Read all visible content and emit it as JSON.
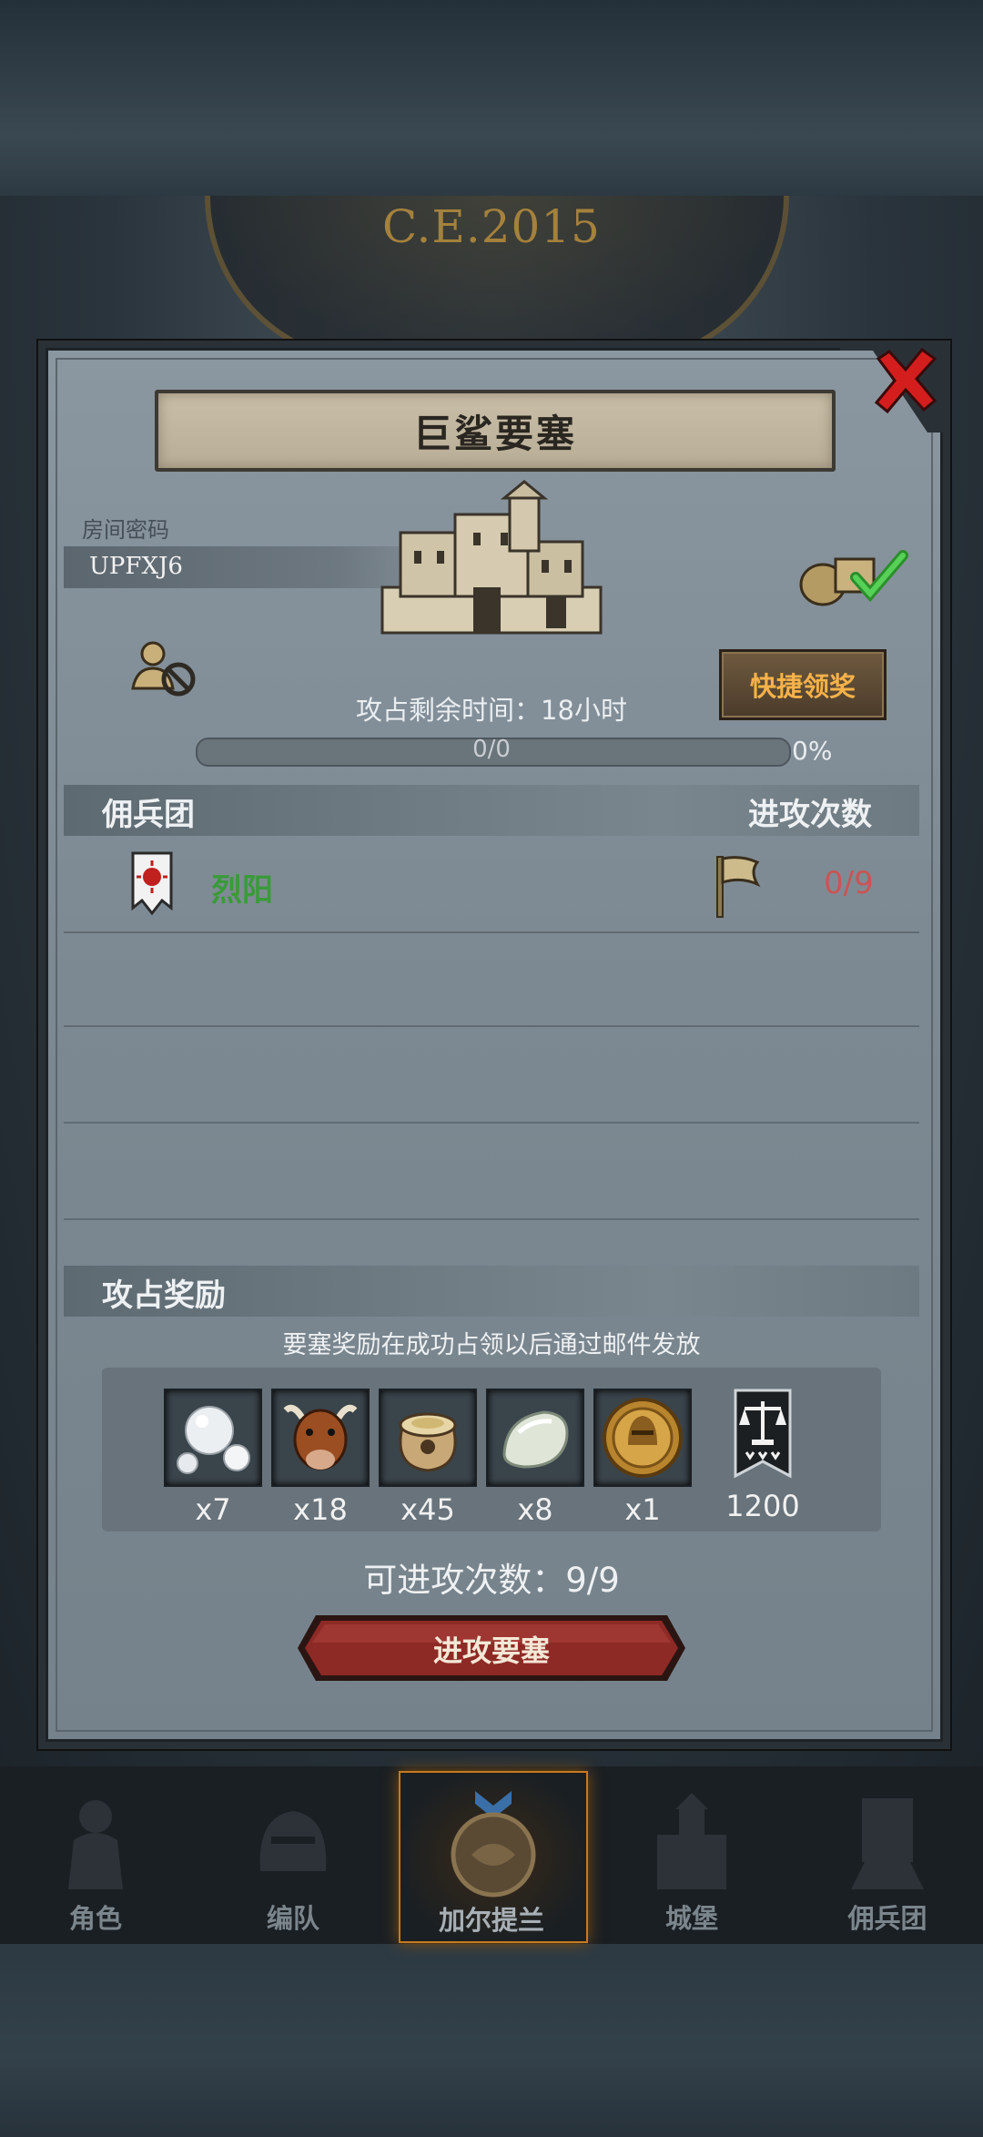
{
  "background": {
    "era_text": "C.E.2015"
  },
  "modal": {
    "title": "巨鲨要塞",
    "room_password_label": "房间密码",
    "room_password_value": "UPFXJ6",
    "quick_claim_label": "快捷领奖",
    "remaining_time_label": "攻占剩余时间：18小时",
    "progress": {
      "text": "0/0",
      "percent_text": "0%",
      "fraction": 0
    },
    "mercenary_header": "佣兵团",
    "attack_count_header": "进攻次数",
    "mercenary_rows": [
      {
        "name": "烈阳",
        "attacks": "0/9"
      }
    ],
    "rewards_header": "攻占奖励",
    "rewards_note": "要塞奖励在成功占领以后通过邮件发放",
    "rewards": [
      {
        "icon": "pearl-icon",
        "qty": "x7"
      },
      {
        "icon": "ox-icon",
        "qty": "x18"
      },
      {
        "icon": "grain-sack-icon",
        "qty": "x45"
      },
      {
        "icon": "white-stone-icon",
        "qty": "x8"
      },
      {
        "icon": "knight-medal-icon",
        "qty": "x1"
      },
      {
        "icon": "justice-banner-icon",
        "qty": "1200"
      }
    ],
    "attacks_available_label": "可进攻次数：9/9",
    "attack_button_label": "进攻要塞"
  },
  "nav": [
    {
      "label": "角色",
      "icon": "knight-icon"
    },
    {
      "label": "编队",
      "icon": "helmet-icon"
    },
    {
      "label": "加尔提兰",
      "icon": "map-medallion-icon",
      "active": true
    },
    {
      "label": "城堡",
      "icon": "castle-icon"
    },
    {
      "label": "佣兵团",
      "icon": "mercenary-icon"
    }
  ],
  "colors": {
    "accent_gold": "#f6b24a",
    "merc_green": "#3a9a3a",
    "attack_red": "#c85555",
    "close_red": "#d41e1e"
  }
}
